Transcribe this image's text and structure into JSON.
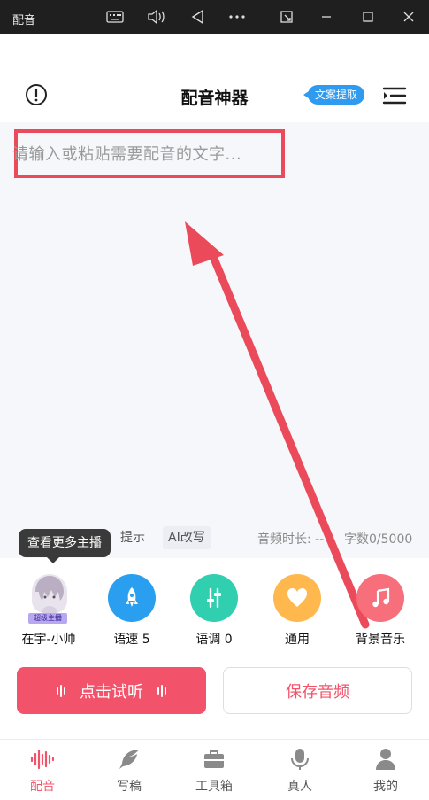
{
  "window": {
    "title": "配音",
    "controls": [
      "keyboard-icon",
      "volume-icon",
      "back-icon",
      "more-icon",
      "screenshot-icon",
      "minimize-icon",
      "maximize-icon",
      "close-icon"
    ]
  },
  "header": {
    "title": "配音神器",
    "extract_label": "文案提取"
  },
  "editor": {
    "placeholder": "请输入或粘贴需要配音的文字...",
    "tools": [
      "AI改写"
    ],
    "hint_partial": "提示",
    "duration_label": "音频时长: --",
    "char_count": "字数0/5000"
  },
  "tooltip": "查看更多主播",
  "voice": {
    "anchor_name": "在宇-小帅",
    "anchor_badge": "超级主播",
    "speed_label": "语速 5",
    "pitch_label": "语调 0",
    "style_label": "通用",
    "bgm_label": "背景音乐"
  },
  "actions": {
    "listen": "点击试听",
    "save": "保存音频"
  },
  "nav": [
    {
      "label": "配音",
      "icon": "waveform-icon",
      "active": true
    },
    {
      "label": "写稿",
      "icon": "feather-icon",
      "active": false
    },
    {
      "label": "工具箱",
      "icon": "toolbox-icon",
      "active": false
    },
    {
      "label": "真人",
      "icon": "microphone-icon",
      "active": false
    },
    {
      "label": "我的",
      "icon": "user-icon",
      "active": false
    }
  ],
  "colors": {
    "accent": "#f2536a",
    "blue": "#2e9bf0",
    "speed": "#2a9ff0",
    "pitch": "#2fcfb0",
    "style": "#ffb84d",
    "bgm": "#f76f7b",
    "annotation": "#ea4a5a"
  }
}
